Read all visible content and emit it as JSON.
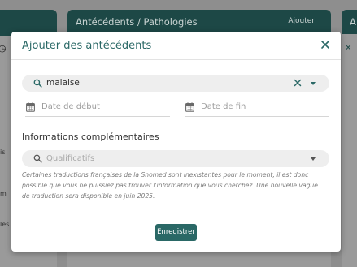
{
  "background": {
    "card_title": "Antécédents / Pathologies",
    "card_link": "Ajouter",
    "right_card_title": "A",
    "left_texts": [
      "is",
      "m",
      "les"
    ]
  },
  "modal": {
    "title": "Ajouter des antécédents",
    "search": {
      "value": "malaise"
    },
    "date_start_placeholder": "Date de début",
    "date_end_placeholder": "Date de fin",
    "section_title": "Informations complémentaires",
    "qualifiers_placeholder": "Qualificatifs",
    "note": "Certaines traductions françaises de la Snomed sont inexistantes pour le moment, il est donc possible que vous ne puissiez pas trouver l'information que vous cherchez. Une nouvelle vague de traduction sera disponible en juin 2025.",
    "save_label": "Enregistrer"
  },
  "colors": {
    "accent": "#2a6866",
    "header_dark": "#1d4846"
  }
}
